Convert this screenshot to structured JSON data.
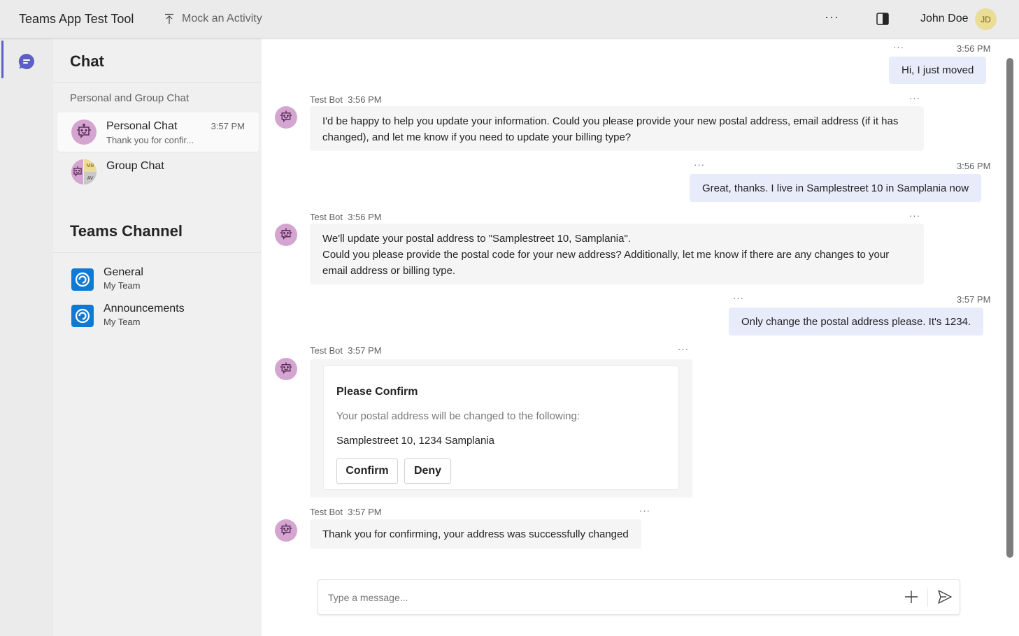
{
  "app": {
    "title": "Teams App Test Tool",
    "mock_activity_label": "Mock an Activity",
    "more_icon": "more-horizontal-icon",
    "panel_icon": "side-panel-icon",
    "user_name": "John Doe",
    "user_initials": "JD"
  },
  "rail": {
    "items": [
      {
        "name": "chat",
        "icon": "chat-icon",
        "active": true
      }
    ]
  },
  "sidebar": {
    "title": "Chat",
    "section_label": "Personal and Group Chat",
    "chats": [
      {
        "name": "Personal Chat",
        "time": "3:57 PM",
        "preview": "Thank you for confir...",
        "active": true
      },
      {
        "name": "Group Chat",
        "time": "",
        "preview": "",
        "active": false,
        "member_initials": [
          "MB",
          "AV"
        ]
      }
    ],
    "channels_title": "Teams Channel",
    "channels": [
      {
        "name": "General",
        "team": "My Team"
      },
      {
        "name": "Announcements",
        "team": "My Team"
      }
    ]
  },
  "conversation": {
    "messages": [
      {
        "direction": "out",
        "time": "3:56 PM",
        "text": "Hi, I just moved"
      },
      {
        "direction": "in",
        "sender": "Test Bot",
        "time": "3:56 PM",
        "text": "I'd be happy to help you update your information. Could you please provide your new postal address, email address (if it has changed), and let me know if you need to update your billing type?"
      },
      {
        "direction": "out",
        "time": "3:56 PM",
        "text": "Great, thanks. I live in Samplestreet 10 in Samplania now"
      },
      {
        "direction": "in",
        "sender": "Test Bot",
        "time": "3:56 PM",
        "text_lines": [
          "We'll update your postal address to \"Samplestreet 10, Samplania\".",
          "Could you please provide the postal code for your new address? Additionally, let me know if there are any changes to your email address or billing type."
        ]
      },
      {
        "direction": "out",
        "time": "3:57 PM",
        "text": "Only change the postal address please. It's 1234."
      },
      {
        "direction": "in",
        "sender": "Test Bot",
        "time": "3:57 PM",
        "card": {
          "title": "Please Confirm",
          "subtitle": "Your postal address will be changed to the following:",
          "address": "Samplestreet 10, 1234 Samplania",
          "actions": [
            "Confirm",
            "Deny"
          ]
        }
      },
      {
        "direction": "in",
        "sender": "Test Bot",
        "time": "3:57 PM",
        "text": "Thank you for confirming, your address was successfully changed"
      }
    ],
    "more_label": "···"
  },
  "composer": {
    "value": "",
    "placeholder": "Type a message...",
    "add_icon": "plus-icon",
    "send_icon": "send-icon"
  },
  "colors": {
    "accent": "#5b5fc7",
    "outgoing_bubble": "#e8ebfa",
    "incoming_bubble": "#f5f5f5",
    "bot_avatar": "#d4a5d0",
    "user_avatar": "#ebdc96",
    "channel_icon": "#0f7ad6"
  }
}
